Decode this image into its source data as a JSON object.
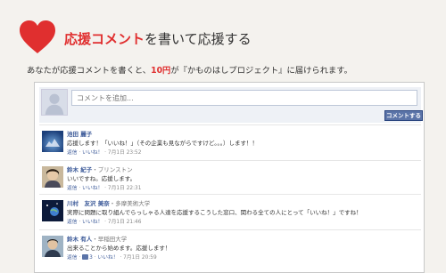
{
  "header": {
    "highlight": "応援コメント",
    "rest": "を書いて応援する"
  },
  "subtitle": {
    "prefix": "あなたが応援コメントを書くと、",
    "amount": "10円",
    "suffix": "が『かものはしプロジェクト』に届けられます。"
  },
  "composer": {
    "placeholder": "コメントを追加...",
    "submit_label": "コメントする"
  },
  "comments": [
    {
      "name": "池田 麗子",
      "school": "",
      "text": "応援します！「いいね！」（その企業も見ながらですけど。。。）します！！",
      "reply": "返信",
      "like": "いいね！",
      "likes_count": "",
      "timestamp": "7月1日 23:52"
    },
    {
      "name": "鈴木 紀子",
      "school": "・プリンストン",
      "text": "いいですね。応援します。",
      "reply": "返信",
      "like": "いいね！",
      "likes_count": "",
      "timestamp": "7月1日 22:31"
    },
    {
      "name": "川村　友沢 美奈",
      "school": "・多摩美術大学",
      "text": "実際に問題に取り組んでらっしゃる人達を応援するこうした窓口、関わる全ての人にとって「いいね！」ですね！",
      "reply": "返信",
      "like": "いいね！",
      "likes_count": "",
      "timestamp": "7月1日 21:46"
    },
    {
      "name": "鈴木 有人",
      "school": "・早稲田大学",
      "text": "出来ることから始めます。応援します！",
      "reply": "返信",
      "like": "いいね！",
      "likes_count": "3",
      "timestamp": "7月1日 20:59"
    }
  ],
  "colors": {
    "accent": "#e02f2f",
    "link": "#3b5998",
    "button": "#5b74a8"
  }
}
